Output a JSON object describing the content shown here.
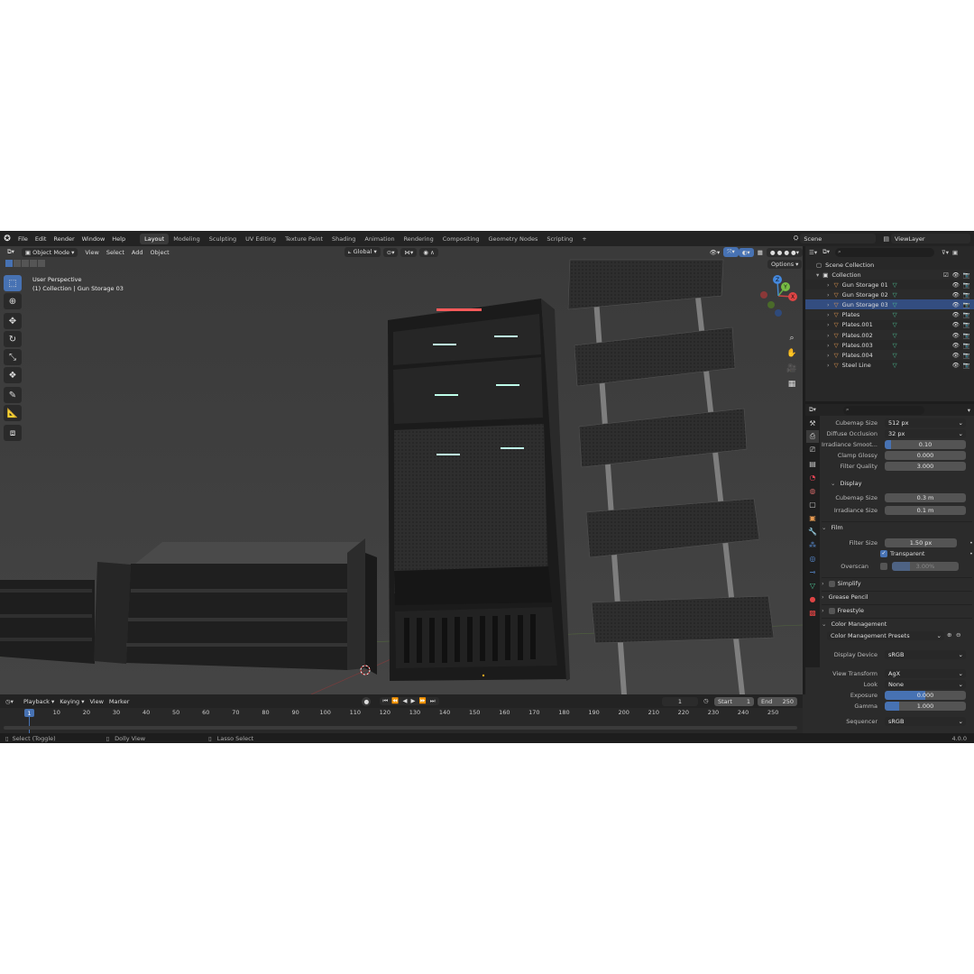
{
  "topbar": {
    "menus": [
      "File",
      "Edit",
      "Render",
      "Window",
      "Help"
    ],
    "workspaces": [
      "Layout",
      "Modeling",
      "Sculpting",
      "UV Editing",
      "Texture Paint",
      "Shading",
      "Animation",
      "Rendering",
      "Compositing",
      "Geometry Nodes",
      "Scripting"
    ],
    "active_workspace": "Layout",
    "add_tab": "+",
    "scene": "Scene",
    "view_layer": "ViewLayer"
  },
  "viewport": {
    "mode": "Object Mode",
    "menus": [
      "View",
      "Select",
      "Add",
      "Object"
    ],
    "orientation": "Global",
    "options": "Options",
    "overlay_line1": "User Perspective",
    "overlay_line2": "(1) Collection | Gun Storage 03",
    "gizmo_axes": [
      "X",
      "Y",
      "Z"
    ]
  },
  "outliner": {
    "root": "Scene Collection",
    "collection": "Collection",
    "items": [
      {
        "name": "Gun Storage 01",
        "selected": false
      },
      {
        "name": "Gun Storage 02",
        "selected": false
      },
      {
        "name": "Gun Storage 03",
        "selected": true
      },
      {
        "name": "Plates",
        "selected": false
      },
      {
        "name": "Plates.001",
        "selected": false
      },
      {
        "name": "Plates.002",
        "selected": false
      },
      {
        "name": "Plates.003",
        "selected": false
      },
      {
        "name": "Plates.004",
        "selected": false
      },
      {
        "name": "Steel Line",
        "selected": false
      }
    ]
  },
  "properties": {
    "cubemap_size_label": "Cubemap Size",
    "cubemap_size": "512 px",
    "diffuse_occlusion_label": "Diffuse Occlusion",
    "diffuse_occlusion": "32 px",
    "irradiance_smooth_label": "Irradiance Smoot...",
    "irradiance_smooth": "0.10",
    "irradiance_smooth_fill": 0.1,
    "clamp_glossy_label": "Clamp Glossy",
    "clamp_glossy": "0.000",
    "filter_quality_label": "Filter Quality",
    "filter_quality": "3.000",
    "display_panel": "Display",
    "display_cubemap_label": "Cubemap Size",
    "display_cubemap": "0.3 m",
    "display_irradiance_label": "Irradiance Size",
    "display_irradiance": "0.1 m",
    "film_panel": "Film",
    "filter_size_label": "Filter Size",
    "filter_size": "1.50 px",
    "transparent_label": "Transparent",
    "overscan_label": "Overscan",
    "overscan": "3.00%",
    "simplify_panel": "Simplify",
    "grease_pencil_panel": "Grease Pencil",
    "freestyle_panel": "Freestyle",
    "color_mgmt_panel": "Color Management",
    "color_presets": "Color Management Presets",
    "display_device_label": "Display Device",
    "display_device": "sRGB",
    "view_transform_label": "View Transform",
    "view_transform": "AgX",
    "look_label": "Look",
    "look": "None",
    "exposure_label": "Exposure",
    "exposure": "0.000",
    "gamma_label": "Gamma",
    "gamma": "1.000",
    "sequencer_label": "Sequencer",
    "sequencer": "sRGB"
  },
  "timeline": {
    "menus": [
      "Playback",
      "Keying",
      "View",
      "Marker"
    ],
    "current_frame": "1",
    "start_label": "Start",
    "start": "1",
    "end_label": "End",
    "end": "250",
    "ticks": [
      "10",
      "20",
      "30",
      "40",
      "50",
      "60",
      "70",
      "80",
      "90",
      "100",
      "110",
      "120",
      "130",
      "140",
      "150",
      "160",
      "170",
      "180",
      "190",
      "200",
      "210",
      "220",
      "230",
      "240",
      "250"
    ],
    "playhead": "1"
  },
  "statusbar": {
    "select": "Select (Toggle)",
    "dolly": "Dolly View",
    "lasso": "Lasso Select",
    "version": "4.0.0"
  },
  "colors": {
    "accent": "#4772b3",
    "viewport_bg": "#3d3d3d",
    "mesh_icon": "#e79b52",
    "filter_icon": "#4ec295"
  }
}
